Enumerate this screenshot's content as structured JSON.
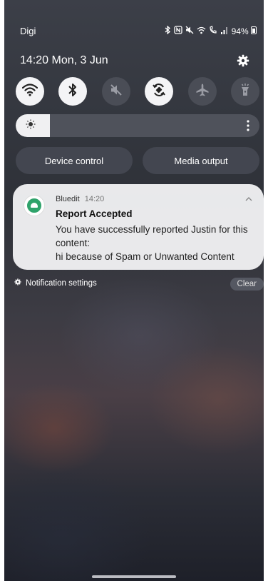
{
  "status_bar": {
    "carrier": "Digi",
    "battery_percent": "94%"
  },
  "quick_settings": {
    "datetime": "14:20  Mon, 3 Jun",
    "tiles": [
      {
        "icon": "wifi-icon",
        "state": "on"
      },
      {
        "icon": "bluetooth-icon",
        "state": "on"
      },
      {
        "icon": "sound-mute-icon",
        "state": "off"
      },
      {
        "icon": "auto-rotate-icon",
        "state": "on"
      },
      {
        "icon": "airplane-mode-icon",
        "state": "off"
      },
      {
        "icon": "flashlight-icon",
        "state": "off"
      }
    ],
    "brightness_level": 0.14,
    "device_control_label": "Device control",
    "media_output_label": "Media output"
  },
  "notification": {
    "app_name": "Bluedit",
    "time": "14:20",
    "title": "Report Accepted",
    "body": "You have successfully reported Justin for this content:\nhi because of Spam or Unwanted Content"
  },
  "footer": {
    "settings_label": "Notification settings",
    "clear_label": "Clear"
  },
  "colors": {
    "app_icon": "#2fa36b",
    "tile_on": "#f4f4f6",
    "tile_off": "#4a4d56"
  }
}
